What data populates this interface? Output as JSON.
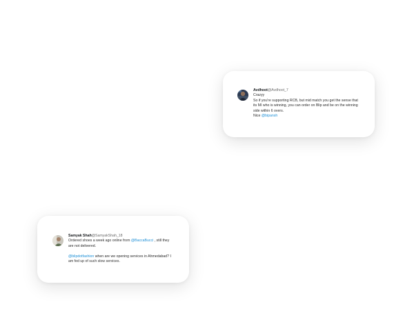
{
  "tweets": [
    {
      "name": "Avdhoot",
      "handle": "@Avdhoot_7",
      "line1": "Crazyy",
      "line2": "So if you're supporting RCB, but mid match you get the sense that its MI who is winning, you can order on Blip and be on the winning side within 6 overs.",
      "line3_prefix": "Nice ",
      "line3_link": "@bipansh"
    },
    {
      "name": "Samyak Shah",
      "handle": "@SamyakShah_18",
      "para1_prefix": "Ordered shoes a week ago online from ",
      "para1_link": "@BaccaBucci",
      "para1_suffix": " , still they are not delivered.",
      "para2_link": "@blipdotfashion",
      "para2_suffix": " when are we opening services in Ahmedabad? I am fed up of such slow services."
    }
  ],
  "colors": {
    "link": "#1d8fd6",
    "name": "#14171a",
    "handle": "#6b6b6b",
    "text": "#2b2b2b"
  },
  "icons": [
    "avatar-avdhoot",
    "avatar-samyak"
  ]
}
